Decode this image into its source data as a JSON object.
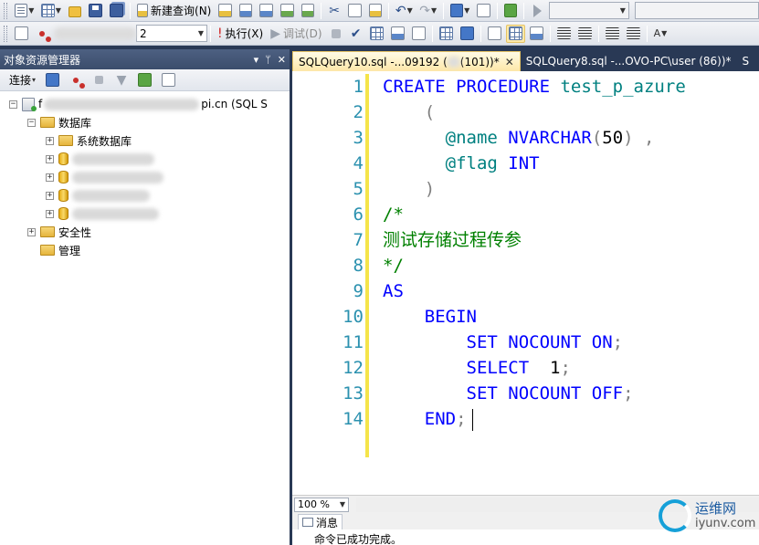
{
  "toolbar_top": {
    "new_query_label": "新建查询(N)"
  },
  "toolbar_second": {
    "db_combo_value": "2",
    "execute_label": "执行(X)",
    "debug_label": "调试(D)"
  },
  "object_explorer": {
    "title": "对象资源管理器",
    "pin_glyphs": "▾ ᛘ ✕",
    "connect_label": "连接",
    "server_node": {
      "prefix": "f",
      "suffix": "pi.cn (SQL S"
    },
    "tree": {
      "databases": "数据库",
      "system_databases": "系统数据库",
      "security": "安全性",
      "management": "管理"
    }
  },
  "documents": {
    "tabs": [
      {
        "label": "SQLQuery10.sql -...09192 (",
        "label_tail": " (101))*",
        "active": true
      },
      {
        "label": "SQLQuery8.sql -...OVO-PC\\user (86))*",
        "active": false
      },
      {
        "label": "S",
        "active": false
      }
    ],
    "close_glyph": "✕"
  },
  "editor": {
    "line_numbers": [
      "1",
      "2",
      "3",
      "4",
      "5",
      "6",
      "7",
      "8",
      "9",
      "10",
      "11",
      "12",
      "13",
      "14"
    ],
    "lines": {
      "l1_kw": "CREATE PROCEDURE",
      "l1_id": "test_p_azure",
      "l2": "    (",
      "l3_id": "@name",
      "l3_kw": "NVARCHAR",
      "l3_p1": "(",
      "l3_num": "50",
      "l3_p2": ") ,",
      "l4_id": "@flag",
      "l4_kw": "INT",
      "l5": "    )",
      "l6": "/*",
      "l7": "测试存储过程传参",
      "l8": "*/",
      "l9": "AS",
      "l10": "    BEGIN",
      "l11_kw": "SET NOCOUNT ON",
      "l11_p": ";",
      "l12_kw": "SELECT",
      "l12_num": "1",
      "l12_p": ";",
      "l13_kw": "SET NOCOUNT OFF",
      "l13_p": ";",
      "l14_kw": "END",
      "l14_p": ";"
    },
    "colors": {
      "keyword": "#0000ff",
      "identifier": "#008080",
      "comment": "#008000",
      "line_number": "#2b91af",
      "change_bar": "#f5e44a"
    }
  },
  "status": {
    "zoom": "100 %",
    "messages_tab": "消息",
    "message": "命令已成功完成。"
  },
  "watermark": {
    "cn": "运维网",
    "en": "iyunv.com"
  }
}
